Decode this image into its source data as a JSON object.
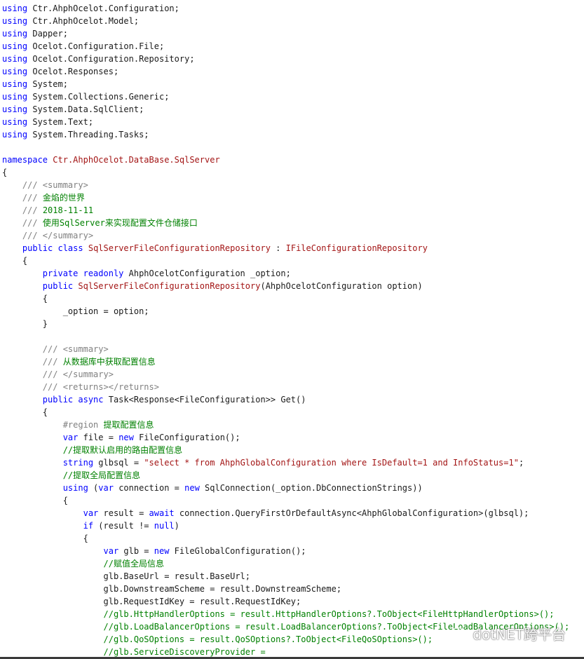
{
  "colors": {
    "keyword": "#0000ff",
    "string": "#a31515",
    "comment": "#008000",
    "doc_tag": "#808080",
    "text": "#1a1a1a",
    "background": "#ffffff"
  },
  "lines": [
    [
      [
        "kw",
        "using"
      ],
      [
        "t",
        " Ctr.AhphOcelot.Configuration;"
      ]
    ],
    [
      [
        "kw",
        "using"
      ],
      [
        "t",
        " Ctr.AhphOcelot.Model;"
      ]
    ],
    [
      [
        "kw",
        "using"
      ],
      [
        "t",
        " Dapper;"
      ]
    ],
    [
      [
        "kw",
        "using"
      ],
      [
        "t",
        " Ocelot.Configuration.File;"
      ]
    ],
    [
      [
        "kw",
        "using"
      ],
      [
        "t",
        " Ocelot.Configuration.Repository;"
      ]
    ],
    [
      [
        "kw",
        "using"
      ],
      [
        "t",
        " Ocelot.Responses;"
      ]
    ],
    [
      [
        "kw",
        "using"
      ],
      [
        "t",
        " System;"
      ]
    ],
    [
      [
        "kw",
        "using"
      ],
      [
        "t",
        " System.Collections.Generic;"
      ]
    ],
    [
      [
        "kw",
        "using"
      ],
      [
        "t",
        " System.Data.SqlClient;"
      ]
    ],
    [
      [
        "kw",
        "using"
      ],
      [
        "t",
        " System.Text;"
      ]
    ],
    [
      [
        "kw",
        "using"
      ],
      [
        "t",
        " System.Threading.Tasks;"
      ]
    ],
    [],
    [
      [
        "kw",
        "namespace"
      ],
      [
        "t",
        " "
      ],
      [
        "ty",
        "Ctr.AhphOcelot.DataBase.SqlServer"
      ]
    ],
    [
      [
        "t",
        "{"
      ]
    ],
    [
      [
        "t",
        "    "
      ],
      [
        "doc",
        "/// <summary>"
      ]
    ],
    [
      [
        "t",
        "    "
      ],
      [
        "doc",
        "/// "
      ],
      [
        "cm",
        "金焰的世界"
      ]
    ],
    [
      [
        "t",
        "    "
      ],
      [
        "doc",
        "/// "
      ],
      [
        "cm",
        "2018-11-11"
      ]
    ],
    [
      [
        "t",
        "    "
      ],
      [
        "doc",
        "/// "
      ],
      [
        "cm",
        "使用SqlServer来实现配置文件仓储接口"
      ]
    ],
    [
      [
        "t",
        "    "
      ],
      [
        "doc",
        "/// </summary>"
      ]
    ],
    [
      [
        "t",
        "    "
      ],
      [
        "kw",
        "public class"
      ],
      [
        "t",
        " "
      ],
      [
        "ty",
        "SqlServerFileConfigurationRepository"
      ],
      [
        "t",
        " : "
      ],
      [
        "ty",
        "IFileConfigurationRepository"
      ]
    ],
    [
      [
        "t",
        "    {"
      ]
    ],
    [
      [
        "t",
        "        "
      ],
      [
        "kw",
        "private readonly"
      ],
      [
        "t",
        " AhphOcelotConfiguration _option;"
      ]
    ],
    [
      [
        "t",
        "        "
      ],
      [
        "kw",
        "public"
      ],
      [
        "t",
        " "
      ],
      [
        "ty",
        "SqlServerFileConfigurationRepository"
      ],
      [
        "t",
        "(AhphOcelotConfiguration option)"
      ]
    ],
    [
      [
        "t",
        "        {"
      ]
    ],
    [
      [
        "t",
        "            _option = option;"
      ]
    ],
    [
      [
        "t",
        "        }"
      ]
    ],
    [],
    [
      [
        "t",
        "        "
      ],
      [
        "doc",
        "/// <summary>"
      ]
    ],
    [
      [
        "t",
        "        "
      ],
      [
        "doc",
        "/// "
      ],
      [
        "cm",
        "从数据库中获取配置信息"
      ]
    ],
    [
      [
        "t",
        "        "
      ],
      [
        "doc",
        "/// </summary>"
      ]
    ],
    [
      [
        "t",
        "        "
      ],
      [
        "doc",
        "/// <returns></returns>"
      ]
    ],
    [
      [
        "t",
        "        "
      ],
      [
        "kw",
        "public async"
      ],
      [
        "t",
        " Task<Response<FileConfiguration>> Get()"
      ]
    ],
    [
      [
        "t",
        "        {"
      ]
    ],
    [
      [
        "t",
        "            "
      ],
      [
        "pre",
        "#region"
      ],
      [
        "cm",
        " 提取配置信息"
      ]
    ],
    [
      [
        "t",
        "            "
      ],
      [
        "kw",
        "var"
      ],
      [
        "t",
        " file = "
      ],
      [
        "kw",
        "new"
      ],
      [
        "t",
        " FileConfiguration();"
      ]
    ],
    [
      [
        "t",
        "            "
      ],
      [
        "cm",
        "//提取默认启用的路由配置信息"
      ]
    ],
    [
      [
        "t",
        "            "
      ],
      [
        "kw",
        "string"
      ],
      [
        "t",
        " glbsql = "
      ],
      [
        "str",
        "\"select * from AhphGlobalConfiguration where IsDefault=1 and InfoStatus=1\""
      ],
      [
        "t",
        ";"
      ]
    ],
    [
      [
        "t",
        "            "
      ],
      [
        "cm",
        "//提取全局配置信息"
      ]
    ],
    [
      [
        "t",
        "            "
      ],
      [
        "kw",
        "using"
      ],
      [
        "t",
        " ("
      ],
      [
        "kw",
        "var"
      ],
      [
        "t",
        " connection = "
      ],
      [
        "kw",
        "new"
      ],
      [
        "t",
        " SqlConnection(_option.DbConnectionStrings))"
      ]
    ],
    [
      [
        "t",
        "            {"
      ]
    ],
    [
      [
        "t",
        "                "
      ],
      [
        "kw",
        "var"
      ],
      [
        "t",
        " result = "
      ],
      [
        "kw",
        "await"
      ],
      [
        "t",
        " connection.QueryFirstOrDefaultAsync<AhphGlobalConfiguration>(glbsql);"
      ]
    ],
    [
      [
        "t",
        "                "
      ],
      [
        "kw",
        "if"
      ],
      [
        "t",
        " (result != "
      ],
      [
        "kw",
        "null"
      ],
      [
        "t",
        ")"
      ]
    ],
    [
      [
        "t",
        "                {"
      ]
    ],
    [
      [
        "t",
        "                    "
      ],
      [
        "kw",
        "var"
      ],
      [
        "t",
        " glb = "
      ],
      [
        "kw",
        "new"
      ],
      [
        "t",
        " FileGlobalConfiguration();"
      ]
    ],
    [
      [
        "t",
        "                    "
      ],
      [
        "cm",
        "//赋值全局信息"
      ]
    ],
    [
      [
        "t",
        "                    glb.BaseUrl = result.BaseUrl;"
      ]
    ],
    [
      [
        "t",
        "                    glb.DownstreamScheme = result.DownstreamScheme;"
      ]
    ],
    [
      [
        "t",
        "                    glb.RequestIdKey = result.RequestIdKey;"
      ]
    ],
    [
      [
        "t",
        "                    "
      ],
      [
        "cm",
        "//glb.HttpHandlerOptions = result.HttpHandlerOptions?.ToObject<FileHttpHandlerOptions>();"
      ]
    ],
    [
      [
        "t",
        "                    "
      ],
      [
        "cm",
        "//glb.LoadBalancerOptions = result.LoadBalancerOptions?.ToObject<FileLoadBalancerOptions>();"
      ]
    ],
    [
      [
        "t",
        "                    "
      ],
      [
        "cm",
        "//glb.QoSOptions = result.QoSOptions?.ToObject<FileQoSOptions>();"
      ]
    ],
    [
      [
        "t",
        "                    "
      ],
      [
        "cm",
        "//glb.ServiceDiscoveryProvider ="
      ]
    ]
  ],
  "watermark": {
    "text": "dotNET跨平台",
    "icon": "wechat-icon"
  }
}
